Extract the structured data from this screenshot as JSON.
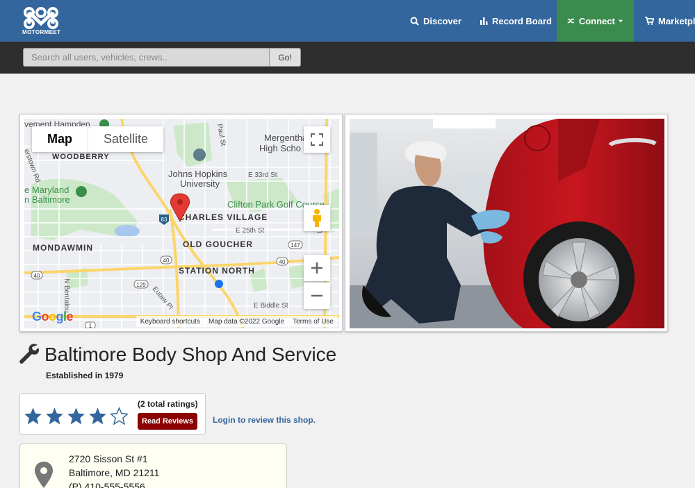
{
  "brand": {
    "name": "MOTORMEET"
  },
  "nav": {
    "discover": "Discover",
    "record_board": "Record Board",
    "connect": "Connect",
    "marketplace": "Marketpla"
  },
  "search": {
    "placeholder": "Search all users, vehicles, crews..",
    "go_label": "Go!"
  },
  "map": {
    "map_tab": "Map",
    "satellite_tab": "Satellite",
    "keyboard_shortcuts": "Keyboard shortcuts",
    "map_data": "Map data ©2022 Google",
    "terms": "Terms of Use",
    "google": "Google",
    "labels": {
      "mergenthaler": "Mergenthaler",
      "high_school": "High Scho",
      "johns_hopkins": "Johns Hopkins",
      "university": "University",
      "maryland": "e Maryland",
      "baltimore": "n Baltimore",
      "clifton": "Clifton Park Golf Course",
      "charles_village": "CHARLES VILLAGE",
      "old_goucher": "OLD GOUCHER",
      "mondawmin": "MONDAWMIN",
      "station_north": "STATION NORTH",
      "woodberry": "WOODBERRY",
      "e33": "E 33rd St",
      "e25": "E 25th St",
      "e_biddle": "E Biddle St",
      "eutaw": "Eutaw Pl",
      "n_bentalou": "N Bentalou",
      "top_label": "vement Hampden",
      "herstown": "erstown Rd",
      "paul_st": "Paul St",
      "lo": "Lo",
      "shield_83": "83",
      "shield_40": "40",
      "shield_147": "147",
      "shield_129": "129",
      "shield_1": "1",
      "byp": "BYP"
    }
  },
  "shop": {
    "name": "Baltimore Body Shop And Service",
    "established": "Established in 1979"
  },
  "rating": {
    "value": 4,
    "max": 5,
    "total": "(2 total ratings)",
    "read_reviews": "Read Reviews",
    "login_prompt": "Login to review this shop."
  },
  "address": {
    "line1": "2720 Sisson St #1",
    "line2": "Baltimore, MD 21211",
    "phone": "(P) 410-555-5556"
  },
  "colors": {
    "nav_bg": "#33669c",
    "connect_bg": "#3c8b4e",
    "reviews_btn": "#8b0000",
    "star": "#33669c"
  }
}
